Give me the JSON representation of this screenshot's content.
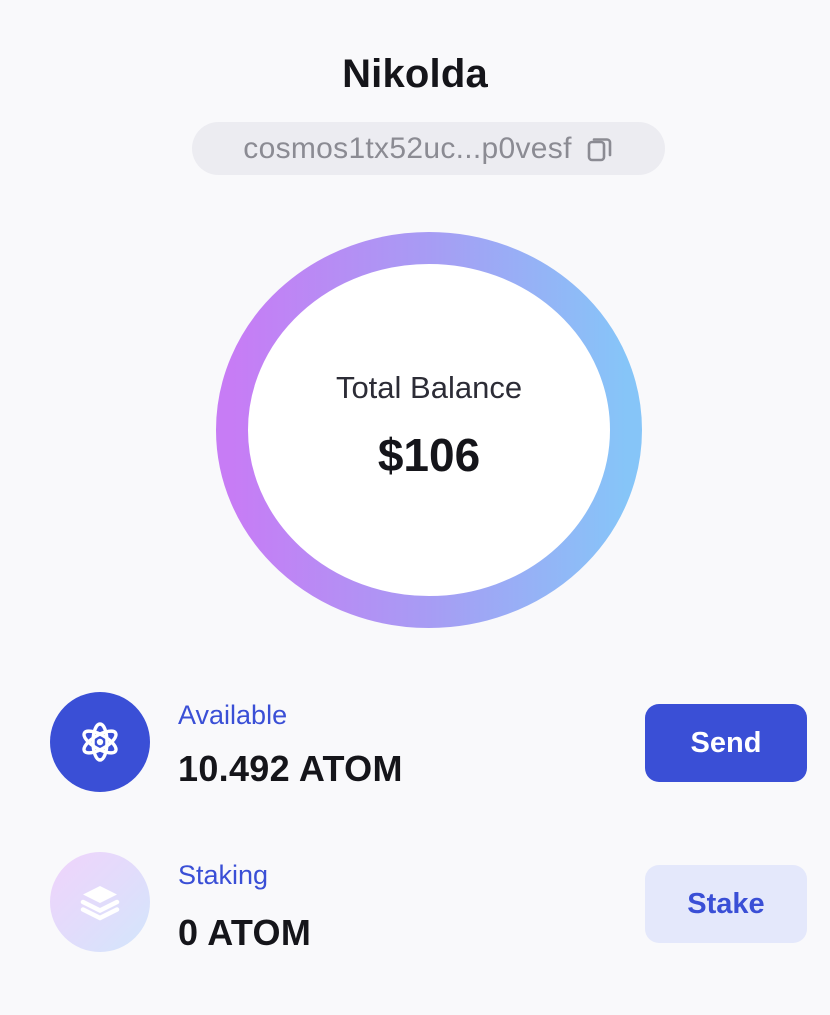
{
  "wallet": {
    "name": "Nikolda",
    "address": "cosmos1tx52uc...p0vesf",
    "copy_icon": "copy-icon"
  },
  "balance": {
    "label": "Total Balance",
    "value": "$106",
    "ring_gradient": [
      "#c77cf5",
      "#a79cf4",
      "#86c5f8"
    ]
  },
  "assets": [
    {
      "label": "Available",
      "amount": "10.492 ATOM",
      "icon": "atom-icon",
      "action": "Send"
    },
    {
      "label": "Staking",
      "amount": "0 ATOM",
      "icon": "stack-layers-icon",
      "action": "Stake"
    }
  ],
  "colors": {
    "accent": "#3a4fd6",
    "background": "#f9f9fb",
    "pill": "#ececf1",
    "secondary_button": "#e4e8fb"
  }
}
